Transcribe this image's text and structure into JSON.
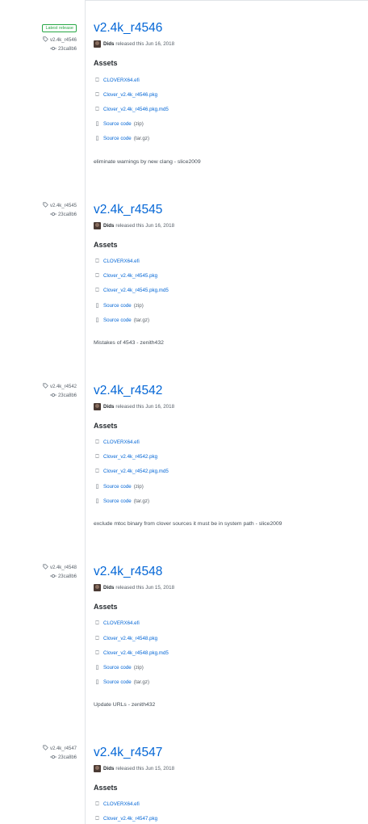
{
  "releases": [
    {
      "latest_label": "Latest release",
      "tag": "v2.4k_r4546",
      "commit": "23ca8b6",
      "title": "v2.4k_r4546",
      "author": "Dids",
      "released": "released this Jun 16, 2018",
      "assets_heading": "Assets",
      "assets": [
        "CLOVERX64.efi",
        "Clover_v2.4k_r4546.pkg",
        "Clover_v2.4k_r4546.pkg.md5"
      ],
      "source_zip": {
        "label": "Source code",
        "ext": "(zip)"
      },
      "source_tar": {
        "label": "Source code",
        "ext": "(tar.gz)"
      },
      "notes": "eliminate warnings by new clang - slice2009"
    },
    {
      "tag": "v2.4k_r4545",
      "commit": "23ca8b6",
      "title": "v2.4k_r4545",
      "author": "Dids",
      "released": "released this Jun 16, 2018",
      "assets_heading": "Assets",
      "assets": [
        "CLOVERX64.efi",
        "Clover_v2.4k_r4545.pkg",
        "Clover_v2.4k_r4545.pkg.md5"
      ],
      "source_zip": {
        "label": "Source code",
        "ext": "(zip)"
      },
      "source_tar": {
        "label": "Source code",
        "ext": "(tar.gz)"
      },
      "notes": "Mistakes of 4543 - zenith432"
    },
    {
      "tag": "v2.4k_r4542",
      "commit": "23ca8b6",
      "title": "v2.4k_r4542",
      "author": "Dids",
      "released": "released this Jun 16, 2018",
      "assets_heading": "Assets",
      "assets": [
        "CLOVERX64.efi",
        "Clover_v2.4k_r4542.pkg",
        "Clover_v2.4k_r4542.pkg.md5"
      ],
      "source_zip": {
        "label": "Source code",
        "ext": "(zip)"
      },
      "source_tar": {
        "label": "Source code",
        "ext": "(tar.gz)"
      },
      "notes": "exclude mtoc binary from clover sources it must be in system path - slice2009"
    },
    {
      "tag": "v2.4k_r4548",
      "commit": "23ca8b6",
      "title": "v2.4k_r4548",
      "author": "Dids",
      "released": "released this Jun 15, 2018",
      "assets_heading": "Assets",
      "assets": [
        "CLOVERX64.efi",
        "Clover_v2.4k_r4548.pkg",
        "Clover_v2.4k_r4548.pkg.md5"
      ],
      "source_zip": {
        "label": "Source code",
        "ext": "(zip)"
      },
      "source_tar": {
        "label": "Source code",
        "ext": "(tar.gz)"
      },
      "notes": "Update URLs - zenith432"
    },
    {
      "tag": "v2.4k_r4547",
      "commit": "23ca8b6",
      "title": "v2.4k_r4547",
      "author": "Dids",
      "released": "released this Jun 15, 2018",
      "assets_heading": "Assets",
      "assets": [
        "CLOVERX64.efi",
        "Clover_v2.4k_r4547.pkg"
      ]
    }
  ]
}
